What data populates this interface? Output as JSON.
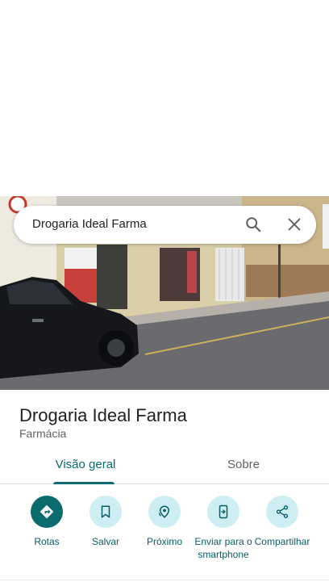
{
  "search": {
    "query": "Drogaria Ideal Farma"
  },
  "place": {
    "title": "Drogaria Ideal Farma",
    "category": "Farmácia"
  },
  "tabs": [
    {
      "label": "Visão geral",
      "active": true
    },
    {
      "label": "Sobre",
      "active": false
    }
  ],
  "actions": [
    {
      "label": "Rotas",
      "icon": "directions-icon"
    },
    {
      "label": "Salvar",
      "icon": "bookmark-icon"
    },
    {
      "label": "Próximo",
      "icon": "nearby-icon"
    },
    {
      "label": "Enviar para o smartphone",
      "icon": "send-to-phone-icon"
    },
    {
      "label": "Compartilhar",
      "icon": "share-icon"
    }
  ],
  "colors": {
    "accent": "#0b6b6e",
    "chip": "#cdeff3"
  }
}
